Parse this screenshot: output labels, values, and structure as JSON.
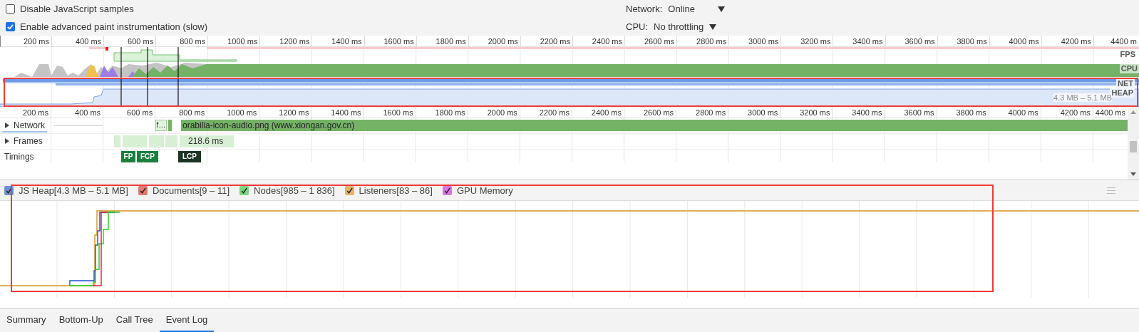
{
  "settings": {
    "checkboxes": [
      {
        "label": "Disable JavaScript samples",
        "checked": false
      },
      {
        "label": "Enable advanced paint instrumentation (slow)",
        "checked": true
      }
    ],
    "throttling": [
      {
        "label": "Network:",
        "value": "Online"
      },
      {
        "label": "CPU:",
        "value": "No throttling"
      }
    ]
  },
  "overview": {
    "ticks": [
      "200 ms",
      "400 ms",
      "600 ms",
      "800 ms",
      "1000 ms",
      "1200 ms",
      "1400 ms",
      "1600 ms",
      "1800 ms",
      "2000 ms",
      "2200 ms",
      "2400 ms",
      "2600 ms",
      "2800 ms",
      "3000 ms",
      "3200 ms",
      "3400 ms",
      "3600 ms",
      "3800 ms",
      "4000 ms",
      "4200 ms",
      "4400 m"
    ],
    "track_labels": [
      "FPS",
      "CPU",
      "NET",
      "HEAP"
    ],
    "heap_range": "4.3 MB – 5.1 MB"
  },
  "timeline": {
    "ticks": [
      "200 ms",
      "400 ms",
      "600 ms",
      "800 ms",
      "1000 ms",
      "1200 ms",
      "1400 ms",
      "1600 ms",
      "1800 ms",
      "2000 ms",
      "2200 ms",
      "2400 ms",
      "2600 ms",
      "2800 ms",
      "3000 ms",
      "3200 ms",
      "3400 ms",
      "3600 ms",
      "3800 ms",
      "4000 ms",
      "4200 ms",
      "4400 ms"
    ],
    "tracks": [
      {
        "kind": "network",
        "label": "Network",
        "expanded": false,
        "short_request": "f…",
        "request": "orabilia-icon-audio.png (www.xiongan.gov.cn)"
      },
      {
        "kind": "frames",
        "label": "Frames",
        "expanded": false,
        "duration": "218.6 ms"
      },
      {
        "kind": "timings",
        "label": "Timings",
        "markers": [
          {
            "label": "FP",
            "color": "#1b7f3e"
          },
          {
            "label": "FCP",
            "color": "#1b7f3e"
          },
          {
            "label": "LCP",
            "color": "#1c3524"
          }
        ]
      }
    ]
  },
  "counters": {
    "items": [
      {
        "label": "JS Heap[4.3 MB – 5.1 MB]",
        "checked": true,
        "color": "#6f8fd6"
      },
      {
        "label": "Documents[9 – 11]",
        "checked": true,
        "color": "#e07a72"
      },
      {
        "label": "Nodes[985 – 1 836]",
        "checked": true,
        "color": "#7ad67a"
      },
      {
        "label": "Listeners[83 – 86]",
        "checked": true,
        "color": "#e2b56a"
      },
      {
        "label": "GPU Memory",
        "checked": true,
        "color": "#d877de"
      }
    ]
  },
  "tabs": [
    {
      "label": "Summary",
      "selected": false
    },
    {
      "label": "Bottom-Up",
      "selected": false
    },
    {
      "label": "Call Tree",
      "selected": false
    },
    {
      "label": "Event Log",
      "selected": true
    }
  ]
}
